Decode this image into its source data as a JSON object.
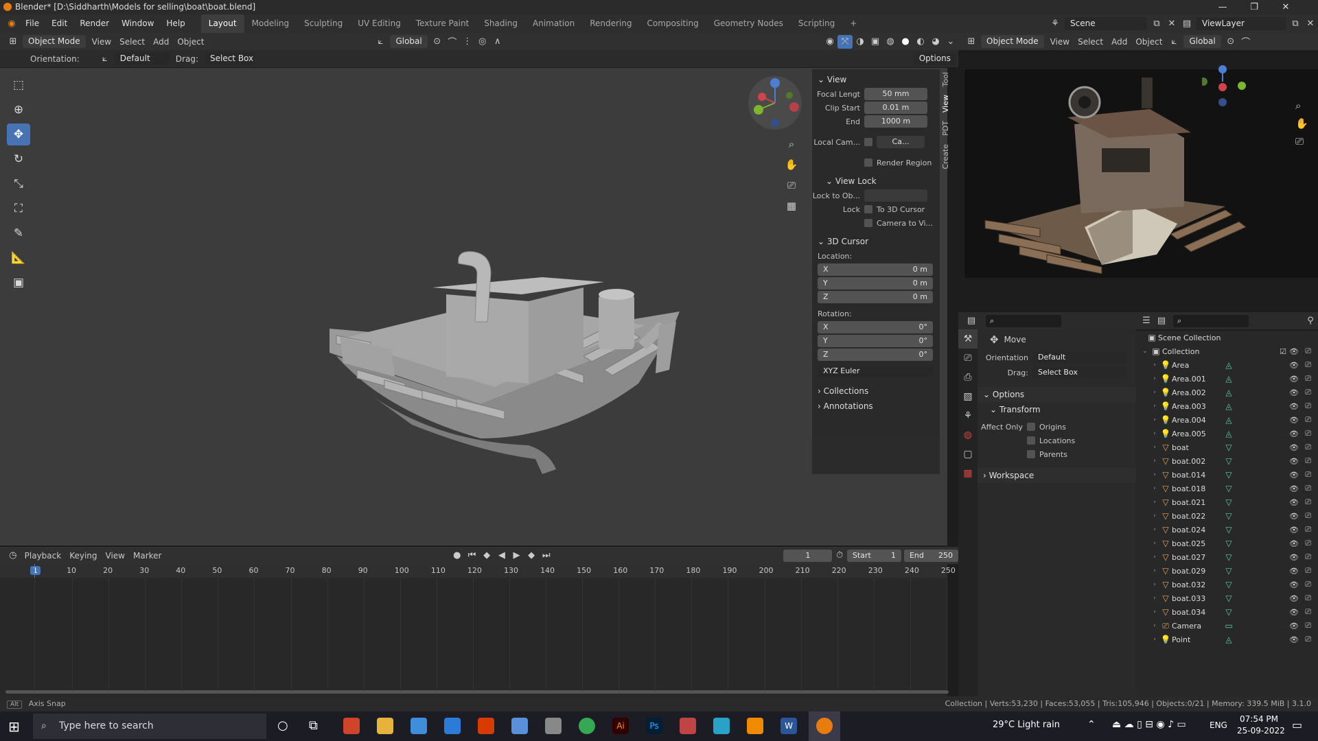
{
  "window": {
    "title": "Blender* [D:\\Siddharth\\Models for selling\\boat\\boat.blend]"
  },
  "menu": [
    "File",
    "Edit",
    "Render",
    "Window",
    "Help"
  ],
  "workspaces": [
    "Layout",
    "Modeling",
    "Sculpting",
    "UV Editing",
    "Texture Paint",
    "Shading",
    "Animation",
    "Rendering",
    "Compositing",
    "Geometry Nodes",
    "Scripting"
  ],
  "scene": {
    "label": "Scene",
    "view_layer": "ViewLayer"
  },
  "viewport_header": {
    "mode": "Object Mode",
    "menus": [
      "View",
      "Select",
      "Add",
      "Object"
    ],
    "transform": "Global",
    "options": "Options"
  },
  "tool_header": {
    "orientation_label": "Orientation:",
    "orientation_value": "Default",
    "drag_label": "Drag:",
    "drag_value": "Select Box"
  },
  "npanel": {
    "tabs": [
      "Tool",
      "View",
      "PDT",
      "Create"
    ],
    "view": {
      "title": "View",
      "focal_label": "Focal Lengt",
      "focal_value": "50 mm",
      "clip_start_label": "Clip Start",
      "clip_start_value": "0.01 m",
      "end_label": "End",
      "end_value": "1000 m",
      "local_cam_label": "Local Cam...",
      "local_cam_value": "Ca...",
      "render_region": "Render Region"
    },
    "view_lock": {
      "title": "View Lock",
      "lock_to_label": "Lock to Ob...",
      "lock_label": "Lock",
      "to_cursor": "To 3D Cursor",
      "camera_to_view": "Camera to Vi..."
    },
    "cursor": {
      "title": "3D Cursor",
      "location_label": "Location:",
      "x_label": "X",
      "x_value": "0 m",
      "y_label": "Y",
      "y_value": "0 m",
      "z_label": "Z",
      "z_value": "0 m",
      "rotation_label": "Rotation:",
      "rx_value": "0°",
      "ry_value": "0°",
      "rz_value": "0°",
      "rotation_mode": "XYZ Euler"
    },
    "collections": "Collections",
    "annotations": "Annotations"
  },
  "timeline": {
    "menus": [
      "Playback",
      "Keying",
      "View",
      "Marker"
    ],
    "current_frame": "1",
    "start_label": "Start",
    "start_value": "1",
    "end_label": "End",
    "end_value": "250",
    "ticks": [
      "1",
      "10",
      "20",
      "30",
      "40",
      "50",
      "60",
      "70",
      "80",
      "90",
      "100",
      "110",
      "120",
      "130",
      "140",
      "150",
      "160",
      "170",
      "180",
      "190",
      "200",
      "210",
      "220",
      "230",
      "240",
      "250"
    ]
  },
  "render_header": {
    "mode": "Object Mode",
    "menus": [
      "View",
      "Select",
      "Add",
      "Object"
    ],
    "transform": "Global"
  },
  "properties": {
    "tool_name": "Move",
    "orientation_label": "Orientation",
    "orientation_value": "Default",
    "drag_label": "Drag:",
    "drag_value": "Select Box",
    "options": "Options",
    "transform": "Transform",
    "affect_only": "Affect Only",
    "origins": "Origins",
    "locations": "Locations",
    "parents": "Parents",
    "workspace": "Workspace"
  },
  "outliner": {
    "scene_collection": "Scene Collection",
    "collection": "Collection",
    "items": [
      {
        "name": "Area",
        "type": "light"
      },
      {
        "name": "Area.001",
        "type": "light"
      },
      {
        "name": "Area.002",
        "type": "light"
      },
      {
        "name": "Area.003",
        "type": "light"
      },
      {
        "name": "Area.004",
        "type": "light"
      },
      {
        "name": "Area.005",
        "type": "light"
      },
      {
        "name": "boat",
        "type": "mesh"
      },
      {
        "name": "boat.002",
        "type": "mesh"
      },
      {
        "name": "boat.014",
        "type": "mesh"
      },
      {
        "name": "boat.018",
        "type": "mesh"
      },
      {
        "name": "boat.021",
        "type": "mesh"
      },
      {
        "name": "boat.022",
        "type": "mesh"
      },
      {
        "name": "boat.024",
        "type": "mesh"
      },
      {
        "name": "boat.025",
        "type": "mesh"
      },
      {
        "name": "boat.027",
        "type": "mesh"
      },
      {
        "name": "boat.029",
        "type": "mesh"
      },
      {
        "name": "boat.032",
        "type": "mesh"
      },
      {
        "name": "boat.033",
        "type": "mesh"
      },
      {
        "name": "boat.034",
        "type": "mesh"
      },
      {
        "name": "Camera",
        "type": "camera"
      },
      {
        "name": "Point",
        "type": "light"
      }
    ]
  },
  "status": {
    "left": "Axis Snap",
    "right": "Collection | Verts:53,230 | Faces:53,055 | Tris:105,946 | Objects:0/21 | Memory: 339.5 MiB | 3.1.0"
  },
  "taskbar": {
    "search_placeholder": "Type here to search",
    "weather": "29°C  Light rain",
    "lang": "ENG",
    "time": "07:54 PM",
    "date": "25-09-2022"
  },
  "colors": {
    "accent": "#4772b3",
    "orange": "#e87d0d",
    "teal": "#59d2a0"
  }
}
